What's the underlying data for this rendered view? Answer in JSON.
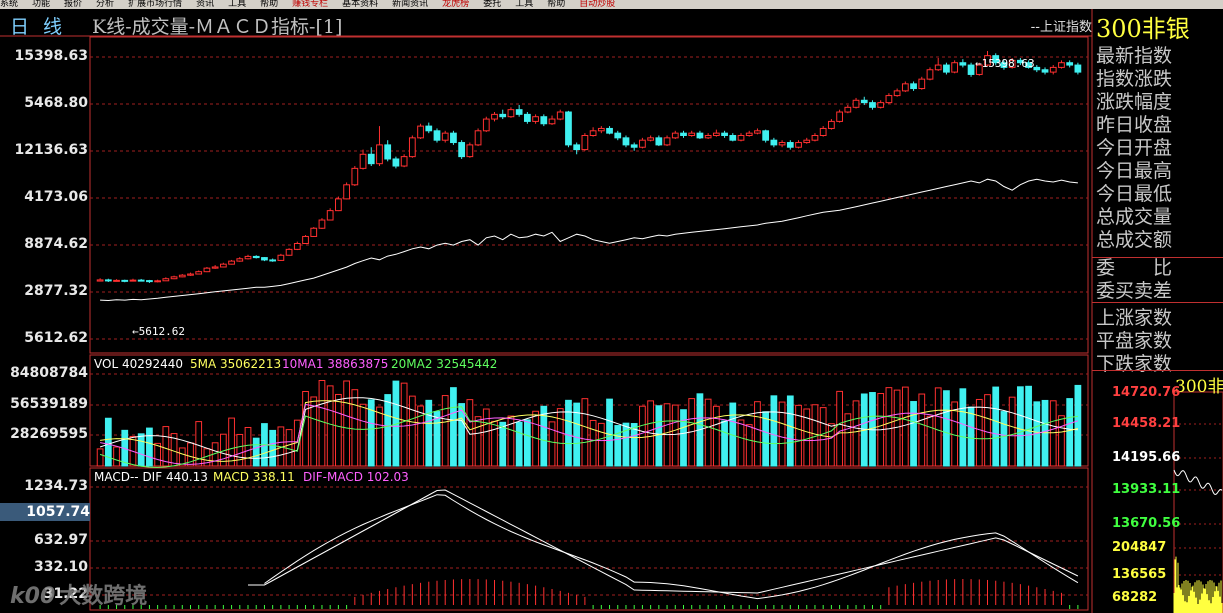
{
  "top_menu": [
    {
      "label": "系统",
      "hl": false
    },
    {
      "label": "功能",
      "hl": false
    },
    {
      "label": "报价",
      "hl": false
    },
    {
      "label": "分析",
      "hl": false
    },
    {
      "label": "扩展市场行情",
      "hl": false
    },
    {
      "label": "资讯",
      "hl": false
    },
    {
      "label": "工具",
      "hl": false
    },
    {
      "label": "帮助",
      "hl": false
    },
    {
      "label": "赚钱专栏",
      "hl": true
    },
    {
      "label": "基本资料",
      "hl": false
    },
    {
      "label": "新闻资讯",
      "hl": false
    },
    {
      "label": "龙虎榜",
      "hl": true
    },
    {
      "label": "委托",
      "hl": false
    },
    {
      "label": "工具",
      "hl": false
    },
    {
      "label": "帮助",
      "hl": false
    },
    {
      "label": "自动炒股",
      "hl": true
    }
  ],
  "title": {
    "period": "日线",
    "name": "K线-成交量-ＭＡＣＤ指标-[1]",
    "index_name": "--上证指数",
    "stock_name": "300非银"
  },
  "info_labels": [
    "最新指数",
    "指数涨跌",
    "涨跌幅度",
    "昨日收盘",
    "今日开盘",
    "今日最高",
    "今日最低",
    "总成交量",
    "总成交额",
    "委　　比",
    "委买卖差",
    "上涨家数",
    "平盘家数",
    "下跌家数"
  ],
  "price_axis": {
    "labels": [
      "15398.63",
      "5468.80",
      "12136.63",
      "4173.06",
      "8874.62",
      "2877.32",
      "5612.62"
    ],
    "annotation_high": "15398.63",
    "annotation_low": "5612.62"
  },
  "volume_pane": {
    "axis_labels": [
      "84808784",
      "56539189",
      "28269595"
    ],
    "legend": [
      {
        "text": "VOL 40292440",
        "color": "#ffffff"
      },
      {
        "text": "5MA 35062213",
        "color": "#ffff60"
      },
      {
        "text": "10MA1 38863875",
        "color": "#ff60ff"
      },
      {
        "text": "20MA2 32545442",
        "color": "#60ff60"
      }
    ]
  },
  "macd_pane": {
    "axis_labels": [
      "1234.73",
      "632.97",
      "332.10",
      "31.22"
    ],
    "cursor_value": "1057.74",
    "legend": [
      {
        "text": "MACD-- DIF 440.13",
        "color": "#ffffff"
      },
      {
        "text": "MACD 338.11",
        "color": "#ffff60"
      },
      {
        "text": "DIF-MACD 102.03",
        "color": "#ff60ff"
      }
    ]
  },
  "mini_chart": {
    "name": "300非",
    "prices": [
      {
        "text": "14720.76",
        "color": "#ff4040"
      },
      {
        "text": "14458.21",
        "color": "#ff4040"
      },
      {
        "text": "14195.66",
        "color": "#ffffff"
      },
      {
        "text": "13933.11",
        "color": "#40ff40"
      },
      {
        "text": "13670.56",
        "color": "#40ff40"
      },
      {
        "text": "204847",
        "color": "#ffff40"
      },
      {
        "text": "136565",
        "color": "#ffff40"
      },
      {
        "text": "68282",
        "color": "#ffff40"
      }
    ]
  },
  "watermark": {
    "logo": "k00",
    "text": "大数跨境"
  },
  "colors": {
    "up": "#ff3030",
    "down": "#40f0f0",
    "grid": "#a02020",
    "border": "#c03030"
  },
  "chart_data": {
    "type": "candlestick",
    "price_range": [
      2877.32,
      15398.63
    ],
    "candles": [
      [
        5600,
        5650,
        5720,
        5580
      ],
      [
        5650,
        5610,
        5700,
        5560
      ],
      [
        5610,
        5630,
        5680,
        5580
      ],
      [
        5630,
        5600,
        5660,
        5550
      ],
      [
        5600,
        5640,
        5700,
        5580
      ],
      [
        5640,
        5620,
        5690,
        5590
      ],
      [
        5620,
        5580,
        5650,
        5520
      ],
      [
        5580,
        5612,
        5660,
        5540
      ],
      [
        5612,
        5700,
        5760,
        5600
      ],
      [
        5700,
        5780,
        5830,
        5680
      ],
      [
        5780,
        5850,
        5900,
        5760
      ],
      [
        5850,
        5900,
        5960,
        5820
      ],
      [
        5900,
        6000,
        6050,
        5880
      ],
      [
        6000,
        6150,
        6200,
        5980
      ],
      [
        6150,
        6200,
        6280,
        6120
      ],
      [
        6200,
        6320,
        6380,
        6180
      ],
      [
        6320,
        6450,
        6500,
        6300
      ],
      [
        6450,
        6550,
        6620,
        6420
      ],
      [
        6550,
        6650,
        6720,
        6520
      ],
      [
        6650,
        6600,
        6700,
        6560
      ],
      [
        6600,
        6500,
        6620,
        6450
      ],
      [
        6500,
        6480,
        6560,
        6420
      ],
      [
        6480,
        6700,
        6760,
        6460
      ],
      [
        6700,
        6950,
        7000,
        6680
      ],
      [
        6950,
        7200,
        7280,
        6920
      ],
      [
        7200,
        7500,
        7560,
        7180
      ],
      [
        7500,
        7850,
        7900,
        7480
      ],
      [
        7850,
        8200,
        8280,
        7820
      ],
      [
        8200,
        8600,
        8700,
        8180
      ],
      [
        8600,
        9100,
        9200,
        8580
      ],
      [
        9100,
        9700,
        9800,
        9080
      ],
      [
        9700,
        10400,
        10500,
        9650
      ],
      [
        10400,
        11000,
        11200,
        10350
      ],
      [
        11000,
        10600,
        11300,
        10500
      ],
      [
        10600,
        11400,
        12200,
        10500
      ],
      [
        11400,
        10800,
        11600,
        10700
      ],
      [
        10800,
        10500,
        10900,
        10400
      ],
      [
        10500,
        10900,
        11000,
        10450
      ],
      [
        10900,
        11700,
        11800,
        10850
      ],
      [
        11700,
        12200,
        12300,
        11650
      ],
      [
        12200,
        12000,
        12350,
        11900
      ],
      [
        12000,
        11600,
        12100,
        11500
      ],
      [
        11600,
        11900,
        12000,
        11500
      ],
      [
        11900,
        11500,
        12000,
        11400
      ],
      [
        11500,
        10900,
        11600,
        10800
      ],
      [
        10900,
        11400,
        11500,
        10850
      ],
      [
        11400,
        12000,
        12100,
        11350
      ],
      [
        12000,
        12500,
        12600,
        11950
      ],
      [
        12500,
        12700,
        12800,
        12400
      ],
      [
        12700,
        12600,
        12900,
        12500
      ],
      [
        12600,
        12900,
        13000,
        12550
      ],
      [
        12900,
        12700,
        13100,
        12600
      ],
      [
        12700,
        12400,
        12800,
        12300
      ],
      [
        12400,
        12600,
        12700,
        12300
      ],
      [
        12600,
        12300,
        12700,
        12200
      ],
      [
        12300,
        12500,
        12650,
        12250
      ],
      [
        12500,
        12800,
        12900,
        12450
      ],
      [
        12800,
        11400,
        12850,
        11300
      ],
      [
        11400,
        11200,
        11500,
        11000
      ],
      [
        11200,
        11800,
        11900,
        11150
      ],
      [
        11800,
        12000,
        12150,
        11750
      ],
      [
        12000,
        12100,
        12200,
        11900
      ],
      [
        12100,
        11900,
        12200,
        11850
      ],
      [
        11900,
        11700,
        12000,
        11600
      ],
      [
        11700,
        11400,
        11800,
        11300
      ],
      [
        11400,
        11300,
        11500,
        11150
      ],
      [
        11300,
        11600,
        11700,
        11250
      ],
      [
        11600,
        11700,
        11800,
        11550
      ],
      [
        11700,
        11400,
        11800,
        11350
      ],
      [
        11400,
        11700,
        11800,
        11350
      ],
      [
        11700,
        11900,
        12000,
        11650
      ],
      [
        11900,
        11800,
        12000,
        11700
      ],
      [
        11800,
        11900,
        12000,
        11750
      ],
      [
        11900,
        11700,
        12000,
        11650
      ],
      [
        11700,
        11800,
        11900,
        11650
      ],
      [
        11800,
        11900,
        12050,
        11750
      ],
      [
        11900,
        11800,
        12000,
        11700
      ],
      [
        11800,
        11600,
        11900,
        11550
      ],
      [
        11600,
        11800,
        11900,
        11550
      ],
      [
        11800,
        11900,
        12000,
        11750
      ],
      [
        11900,
        12000,
        12100,
        11850
      ],
      [
        12000,
        11600,
        12050,
        11500
      ],
      [
        11600,
        11400,
        11700,
        11300
      ],
      [
        11400,
        11500,
        11600,
        11300
      ],
      [
        11500,
        11300,
        11600,
        11200
      ],
      [
        11300,
        11500,
        11600,
        11250
      ],
      [
        11500,
        11600,
        11700,
        11450
      ],
      [
        11600,
        11800,
        11900,
        11550
      ],
      [
        11800,
        12100,
        12200,
        11750
      ],
      [
        12100,
        12400,
        12500,
        12050
      ],
      [
        12400,
        12800,
        12900,
        12350
      ],
      [
        12800,
        13000,
        13100,
        12750
      ],
      [
        13000,
        13300,
        13400,
        12950
      ],
      [
        13300,
        13200,
        13450,
        13100
      ],
      [
        13200,
        13000,
        13300,
        12900
      ],
      [
        13000,
        13200,
        13300,
        12950
      ],
      [
        13200,
        13500,
        13600,
        13150
      ],
      [
        13500,
        13700,
        13800,
        13450
      ],
      [
        13700,
        14000,
        14100,
        13650
      ],
      [
        14000,
        13800,
        14100,
        13700
      ],
      [
        13800,
        14200,
        14300,
        13750
      ],
      [
        14200,
        14600,
        14700,
        14150
      ],
      [
        14600,
        14800,
        15100,
        14550
      ],
      [
        14800,
        14500,
        14900,
        14400
      ],
      [
        14500,
        14900,
        15000,
        14450
      ],
      [
        14900,
        14800,
        15050,
        14700
      ],
      [
        14800,
        14400,
        14900,
        14300
      ],
      [
        14400,
        14800,
        14900,
        14350
      ],
      [
        14800,
        15200,
        15400,
        14750
      ],
      [
        15200,
        14900,
        15300,
        14800
      ],
      [
        14900,
        14700,
        15000,
        14600
      ],
      [
        14700,
        15000,
        15100,
        14650
      ],
      [
        15000,
        14900,
        15100,
        14800
      ],
      [
        14900,
        14700,
        15000,
        14650
      ],
      [
        14700,
        14600,
        14800,
        14500
      ],
      [
        14600,
        14500,
        14700,
        14400
      ],
      [
        14500,
        14700,
        14800,
        14400
      ],
      [
        14700,
        14900,
        15000,
        14650
      ],
      [
        14900,
        14800,
        15000,
        14700
      ],
      [
        14800,
        14500,
        14900,
        14400
      ]
    ],
    "index_line": [
      5500,
      5480,
      5520,
      5500,
      5540,
      5520,
      5560,
      5600,
      5650,
      5700,
      5750,
      5800,
      5850,
      5900,
      5950,
      6000,
      6050,
      6100,
      6150,
      6200,
      6200,
      6250,
      6300,
      6400,
      6500,
      6600,
      6700,
      6850,
      7000,
      7150,
      7300,
      7500,
      7650,
      7800,
      7700,
      7900,
      8000,
      8150,
      8300,
      8400,
      8300,
      8500,
      8600,
      8500,
      8700,
      8800,
      8500,
      8900,
      9000,
      8800,
      9100,
      8900,
      8950,
      9100,
      9000,
      9200,
      8700,
      8900,
      9100,
      9000,
      8800,
      8700,
      8600,
      8700,
      8800,
      8900,
      8850,
      8950,
      9050,
      9000,
      9100,
      9150,
      9200,
      9250,
      9300,
      9350,
      9400,
      9450,
      9500,
      9550,
      9600,
      9700,
      9750,
      9800,
      9900,
      10000,
      10100,
      10200,
      10300,
      10350,
      10400,
      10500,
      10600,
      10700,
      10800,
      10900,
      11000,
      11100,
      11200,
      11300,
      11400,
      11500,
      11600,
      11700,
      11800,
      11900,
      12000,
      11900,
      12100,
      12000,
      11700,
      11500,
      11800,
      12000,
      12100,
      12000,
      11950,
      12050,
      11950,
      11900
    ]
  }
}
